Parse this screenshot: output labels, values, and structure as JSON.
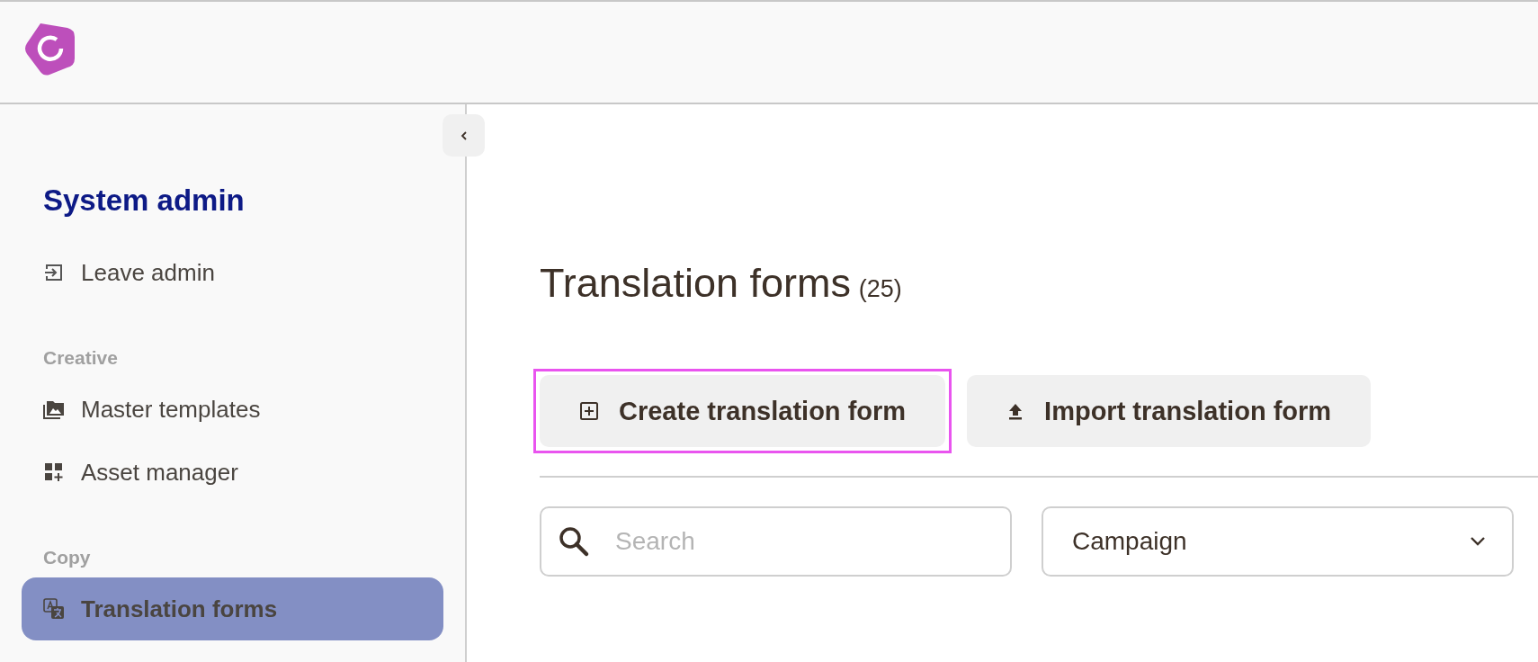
{
  "sidebar": {
    "title": "System admin",
    "leave": {
      "label": "Leave admin"
    },
    "sections": [
      {
        "heading": "Creative",
        "items": [
          {
            "label": "Master templates",
            "selected": false
          },
          {
            "label": "Asset manager",
            "selected": false
          }
        ]
      },
      {
        "heading": "Copy",
        "items": [
          {
            "label": "Translation forms",
            "selected": true
          }
        ]
      }
    ]
  },
  "page": {
    "title": "Translation forms",
    "count": "(25)",
    "actions": [
      {
        "label": "Create translation form",
        "focused": true
      },
      {
        "label": "Import translation form",
        "focused": false
      }
    ],
    "search": {
      "placeholder": "Search"
    },
    "filter": {
      "value": "Campaign"
    }
  }
}
